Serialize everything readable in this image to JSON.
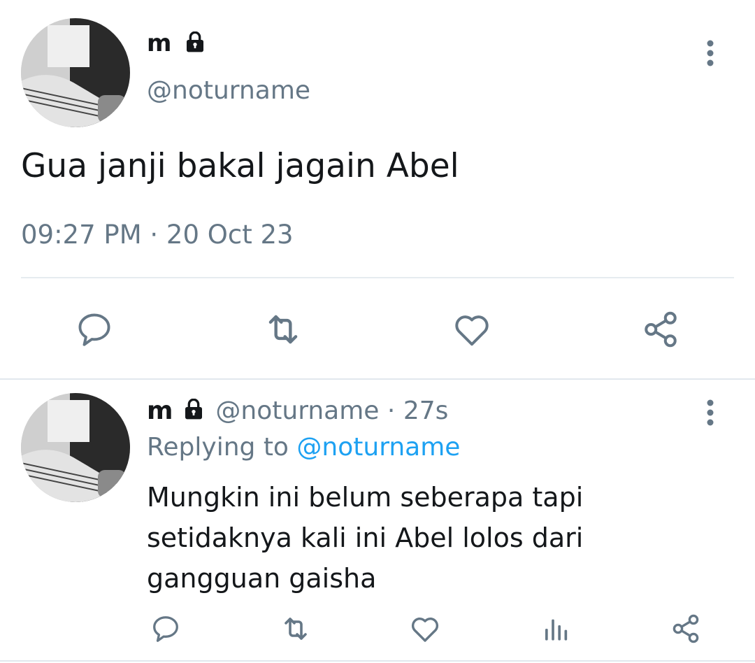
{
  "main_tweet": {
    "author_name": "m",
    "author_handle": "@noturname",
    "text": "Gua janji bakal jagain Abel",
    "timestamp": "09:27 PM · 20 Oct 23",
    "actions": [
      "reply-icon",
      "retweet-icon",
      "like-icon",
      "share-icon"
    ]
  },
  "reply_tweet": {
    "author_name": "m",
    "author_handle": "@noturname",
    "separator": "·",
    "age": "27s",
    "replying_prefix": "Replying to",
    "replying_handle": "@noturname",
    "text_lines": [
      "Mungkin ini belum seberapa tapi",
      "setidaknya kali ini Abel lolos dari",
      "gangguan gaisha"
    ],
    "actions": [
      "reply-icon",
      "retweet-icon",
      "like-icon",
      "analytics-icon",
      "share-icon"
    ]
  },
  "colors": {
    "text": "#14171a",
    "secondary": "#657786",
    "link": "#1da1f2",
    "divider": "#e6ecf0"
  }
}
